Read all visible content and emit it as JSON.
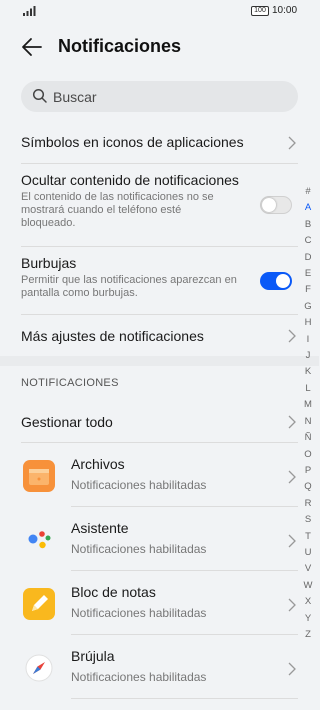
{
  "status_bar": {
    "time": "10:00",
    "battery": "100"
  },
  "header": {
    "title": "Notificaciones"
  },
  "search": {
    "placeholder": "Buscar"
  },
  "settings": {
    "app_icon_badges": "Símbolos en iconos de aplicaciones",
    "hide_content": {
      "title": "Ocultar contenido de notificaciones",
      "description": "El contenido de las notificaciones no se mostrará cuando el teléfono esté bloqueado.",
      "enabled": false
    },
    "bubbles": {
      "title": "Burbujas",
      "description": "Permitir que las notificaciones aparezcan en pantalla como burbujas.",
      "enabled": true
    },
    "more_settings": "Más ajustes de notificaciones"
  },
  "section": {
    "label": "NOTIFICACIONES",
    "manage_all": "Gestionar todo"
  },
  "apps": [
    {
      "name": "Archivos",
      "status": "Notificaciones habilitadas",
      "icon": "files-icon"
    },
    {
      "name": "Asistente",
      "status": "Notificaciones habilitadas",
      "icon": "assistant-icon"
    },
    {
      "name": "Bloc de notas",
      "status": "Notificaciones habilitadas",
      "icon": "notepad-icon"
    },
    {
      "name": "Brújula",
      "status": "Notificaciones habilitadas",
      "icon": "compass-icon"
    }
  ],
  "alphabet_index": [
    "#",
    "A",
    "B",
    "C",
    "D",
    "E",
    "F",
    "G",
    "H",
    "I",
    "J",
    "K",
    "L",
    "M",
    "N",
    "Ñ",
    "O",
    "P",
    "Q",
    "R",
    "S",
    "T",
    "U",
    "V",
    "W",
    "X",
    "Y",
    "Z"
  ],
  "active_letter": "A",
  "colors": {
    "accent": "#0a59f7",
    "background": "#f1f3f5"
  }
}
